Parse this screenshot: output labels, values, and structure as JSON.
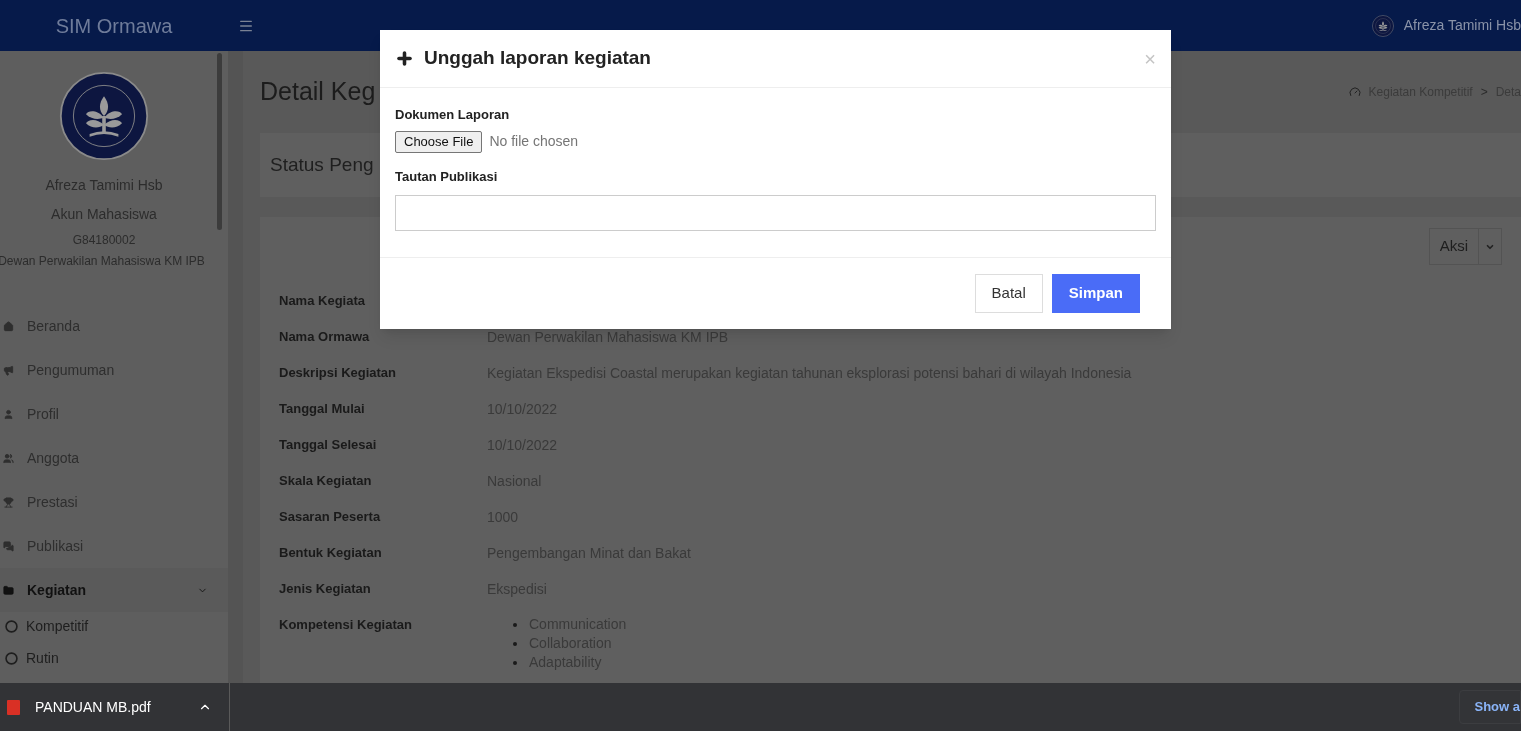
{
  "header": {
    "brand": "SIM Ormawa",
    "user_name": "Afreza Tamimi Hsb"
  },
  "sidebar": {
    "profile": {
      "name": "Afreza Tamimi Hsb",
      "role": "Akun Mahasiswa",
      "id_number": "G84180002",
      "organization": "Dewan Perwakilan Mahasiswa KM IPB"
    },
    "items": [
      {
        "label": "Beranda",
        "selected": false
      },
      {
        "label": "Pengumuman",
        "selected": false
      },
      {
        "label": "Profil",
        "selected": false
      },
      {
        "label": "Anggota",
        "selected": false
      },
      {
        "label": "Prestasi",
        "selected": false
      },
      {
        "label": "Publikasi",
        "selected": false
      },
      {
        "label": "Kegiatan",
        "selected": true,
        "expanded": true,
        "children": [
          {
            "label": "Kompetitif"
          },
          {
            "label": "Rutin"
          }
        ]
      }
    ]
  },
  "page": {
    "title": "Detail Keg",
    "breadcrumb": [
      {
        "label": "Kegiatan Kompetitif"
      },
      {
        "label": "Deta"
      }
    ],
    "breadcrumb_separator": ">",
    "status_title": "Status Peng",
    "action_button": "Aksi",
    "details": [
      {
        "label": "Nama Kegiata"
      },
      {
        "label": "Nama Ormawa",
        "value": "Dewan Perwakilan Mahasiswa KM IPB"
      },
      {
        "label": "Deskripsi Kegiatan",
        "value": "Kegiatan Ekspedisi Coastal merupakan kegiatan tahunan eksplorasi potensi bahari di wilayah Indonesia"
      },
      {
        "label": "Tanggal Mulai",
        "value": "10/10/2022"
      },
      {
        "label": "Tanggal Selesai",
        "value": "10/10/2022"
      },
      {
        "label": "Skala Kegiatan",
        "value": "Nasional"
      },
      {
        "label": "Sasaran Peserta",
        "value": "1000"
      },
      {
        "label": "Bentuk Kegiatan",
        "value": "Pengembangan Minat dan Bakat"
      },
      {
        "label": "Jenis Kegiatan",
        "value": "Ekspedisi"
      },
      {
        "label": "Kompetensi Kegiatan",
        "values": [
          "Communication",
          "Collaboration",
          "Adaptability"
        ]
      }
    ]
  },
  "modal": {
    "title": "Unggah laporan kegiatan",
    "close": "×",
    "fields": [
      {
        "kind": "file",
        "label": "Dokumen Laporan",
        "button": "Choose File",
        "status": "No file chosen"
      },
      {
        "kind": "text",
        "label": "Tautan Publikasi"
      }
    ],
    "buttons": [
      {
        "label": "Batal",
        "kind": "default"
      },
      {
        "label": "Simpan",
        "kind": "primary"
      }
    ]
  },
  "downloads": {
    "file": "PANDUAN MB.pdf",
    "show_all": "Show a"
  }
}
